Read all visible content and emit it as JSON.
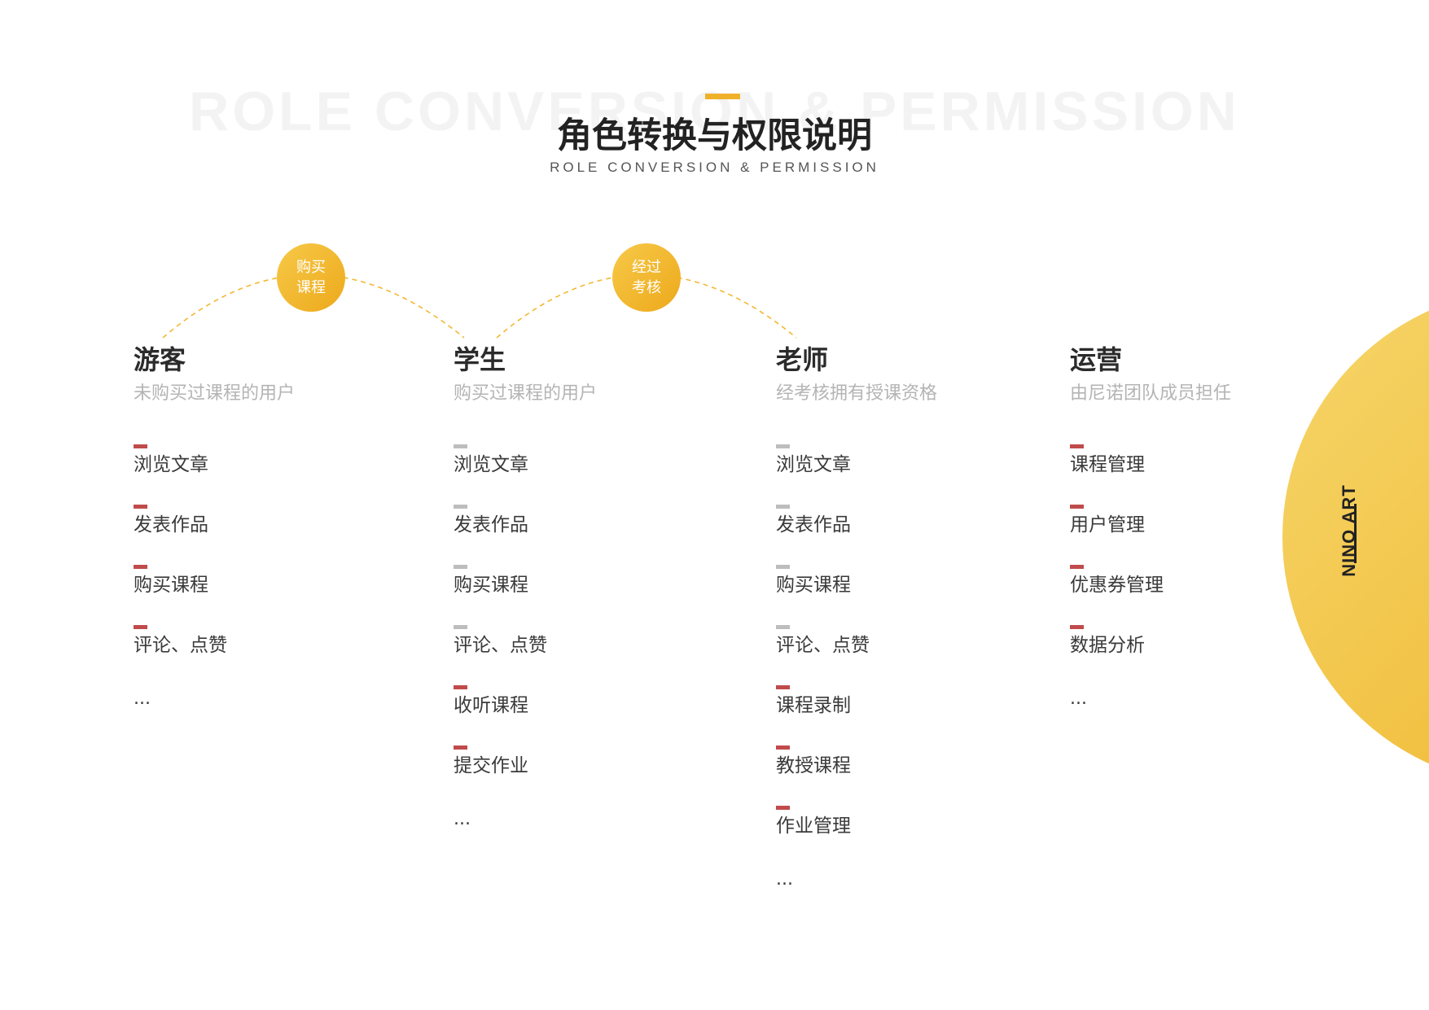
{
  "header": {
    "bg_text": "ROLE CONVERSION & PERMISSION",
    "title": "角色转换与权限说明",
    "subtitle": "ROLE CONVERSION & PERMISSION"
  },
  "transitions": [
    {
      "line1": "购买",
      "line2": "课程"
    },
    {
      "line1": "经过",
      "line2": "考核"
    }
  ],
  "roles": [
    {
      "name": "游客",
      "desc": "未购买过课程的用户",
      "permissions": [
        {
          "label": "浏览文章",
          "mark": "red"
        },
        {
          "label": "发表作品",
          "mark": "red"
        },
        {
          "label": "购买课程",
          "mark": "red"
        },
        {
          "label": "评论、点赞",
          "mark": "red"
        }
      ],
      "more": "..."
    },
    {
      "name": "学生",
      "desc": "购买过课程的用户",
      "permissions": [
        {
          "label": "浏览文章",
          "mark": "gray"
        },
        {
          "label": "发表作品",
          "mark": "gray"
        },
        {
          "label": "购买课程",
          "mark": "gray"
        },
        {
          "label": "评论、点赞",
          "mark": "gray"
        },
        {
          "label": "收听课程",
          "mark": "red"
        },
        {
          "label": "提交作业",
          "mark": "red"
        }
      ],
      "more": "..."
    },
    {
      "name": "老师",
      "desc": "经考核拥有授课资格",
      "permissions": [
        {
          "label": "浏览文章",
          "mark": "gray"
        },
        {
          "label": "发表作品",
          "mark": "gray"
        },
        {
          "label": "购买课程",
          "mark": "gray"
        },
        {
          "label": "评论、点赞",
          "mark": "gray"
        },
        {
          "label": "课程录制",
          "mark": "red"
        },
        {
          "label": "教授课程",
          "mark": "red"
        },
        {
          "label": "作业管理",
          "mark": "red"
        }
      ],
      "more": "..."
    },
    {
      "name": "运营",
      "desc": "由尼诺团队成员担任",
      "permissions": [
        {
          "label": "课程管理",
          "mark": "red"
        },
        {
          "label": "用户管理",
          "mark": "red"
        },
        {
          "label": "优惠券管理",
          "mark": "red"
        },
        {
          "label": "数据分析",
          "mark": "red"
        }
      ],
      "more": "..."
    }
  ],
  "brand": "NINO ART",
  "colors": {
    "accent": "#f0b12a",
    "badge_start": "#f7c948",
    "badge_end": "#eda91c",
    "mark_new": "#c14b4b",
    "mark_inherited": "#bdbdbd",
    "desc_text": "#b4b4b4"
  }
}
